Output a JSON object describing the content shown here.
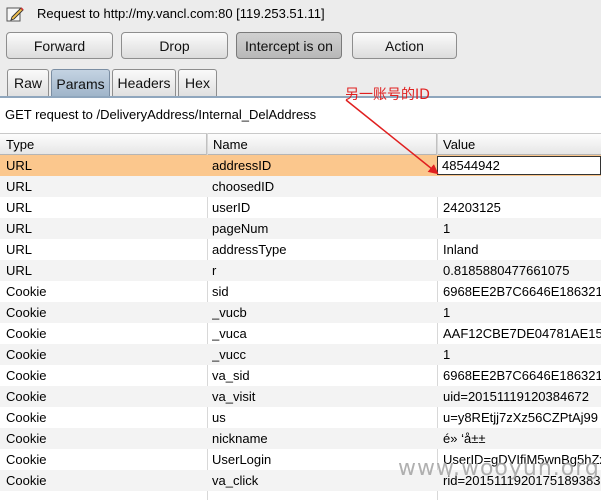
{
  "window": {
    "title": "Request to http://my.vancl.com:80  [119.253.51.11]",
    "icon": "pencil-edit-icon"
  },
  "toolbar": {
    "buttons": [
      {
        "label": "Forward",
        "active": false
      },
      {
        "label": "Drop",
        "active": false
      },
      {
        "label": "Intercept is on",
        "active": true
      },
      {
        "label": "Action",
        "active": false
      }
    ]
  },
  "tabs": [
    {
      "label": "Raw",
      "selected": false
    },
    {
      "label": "Params",
      "selected": true
    },
    {
      "label": "Headers",
      "selected": false
    },
    {
      "label": "Hex",
      "selected": false
    }
  ],
  "summary": "GET request to /DeliveryAddress/Internal_DelAddress",
  "table": {
    "columns": [
      "Type",
      "Name",
      "Value"
    ],
    "rows": [
      {
        "type": "URL",
        "name": "addressID",
        "value": "48544942"
      },
      {
        "type": "URL",
        "name": "choosedID",
        "value": ""
      },
      {
        "type": "URL",
        "name": "userID",
        "value": "24203125"
      },
      {
        "type": "URL",
        "name": "pageNum",
        "value": "1"
      },
      {
        "type": "URL",
        "name": "addressType",
        "value": "Inland"
      },
      {
        "type": "URL",
        "name": "r",
        "value": "0.8185880477661075"
      },
      {
        "type": "Cookie",
        "name": "sid",
        "value": "6968EE2B7C6646E186321"
      },
      {
        "type": "Cookie",
        "name": "_vucb",
        "value": "1"
      },
      {
        "type": "Cookie",
        "name": "_vuca",
        "value": "AAF12CBE7DE04781AE15"
      },
      {
        "type": "Cookie",
        "name": "_vucc",
        "value": "1"
      },
      {
        "type": "Cookie",
        "name": "va_sid",
        "value": "6968EE2B7C6646E186321"
      },
      {
        "type": "Cookie",
        "name": "va_visit",
        "value": "uid=20151119120384672"
      },
      {
        "type": "Cookie",
        "name": "us",
        "value": "u=y8REtjj7zXz56CZPtAj99"
      },
      {
        "type": "Cookie",
        "name": "nickname",
        "value": "é» ‘å±±"
      },
      {
        "type": "Cookie",
        "name": "UserLogin",
        "value": "UserID=gDVIfiM5wnBg5hZx"
      },
      {
        "type": "Cookie",
        "name": "va_click",
        "value": "rid=2015111920175189383"
      }
    ],
    "selected_row": 0,
    "editing_value": "48544942"
  },
  "annotation": {
    "text": "另一账号的ID",
    "color": "#e02020"
  },
  "watermark": "www.wooyun.org",
  "colors": {
    "selected_row": "#fbc78d",
    "tab_selected": "#a9bdd0"
  }
}
